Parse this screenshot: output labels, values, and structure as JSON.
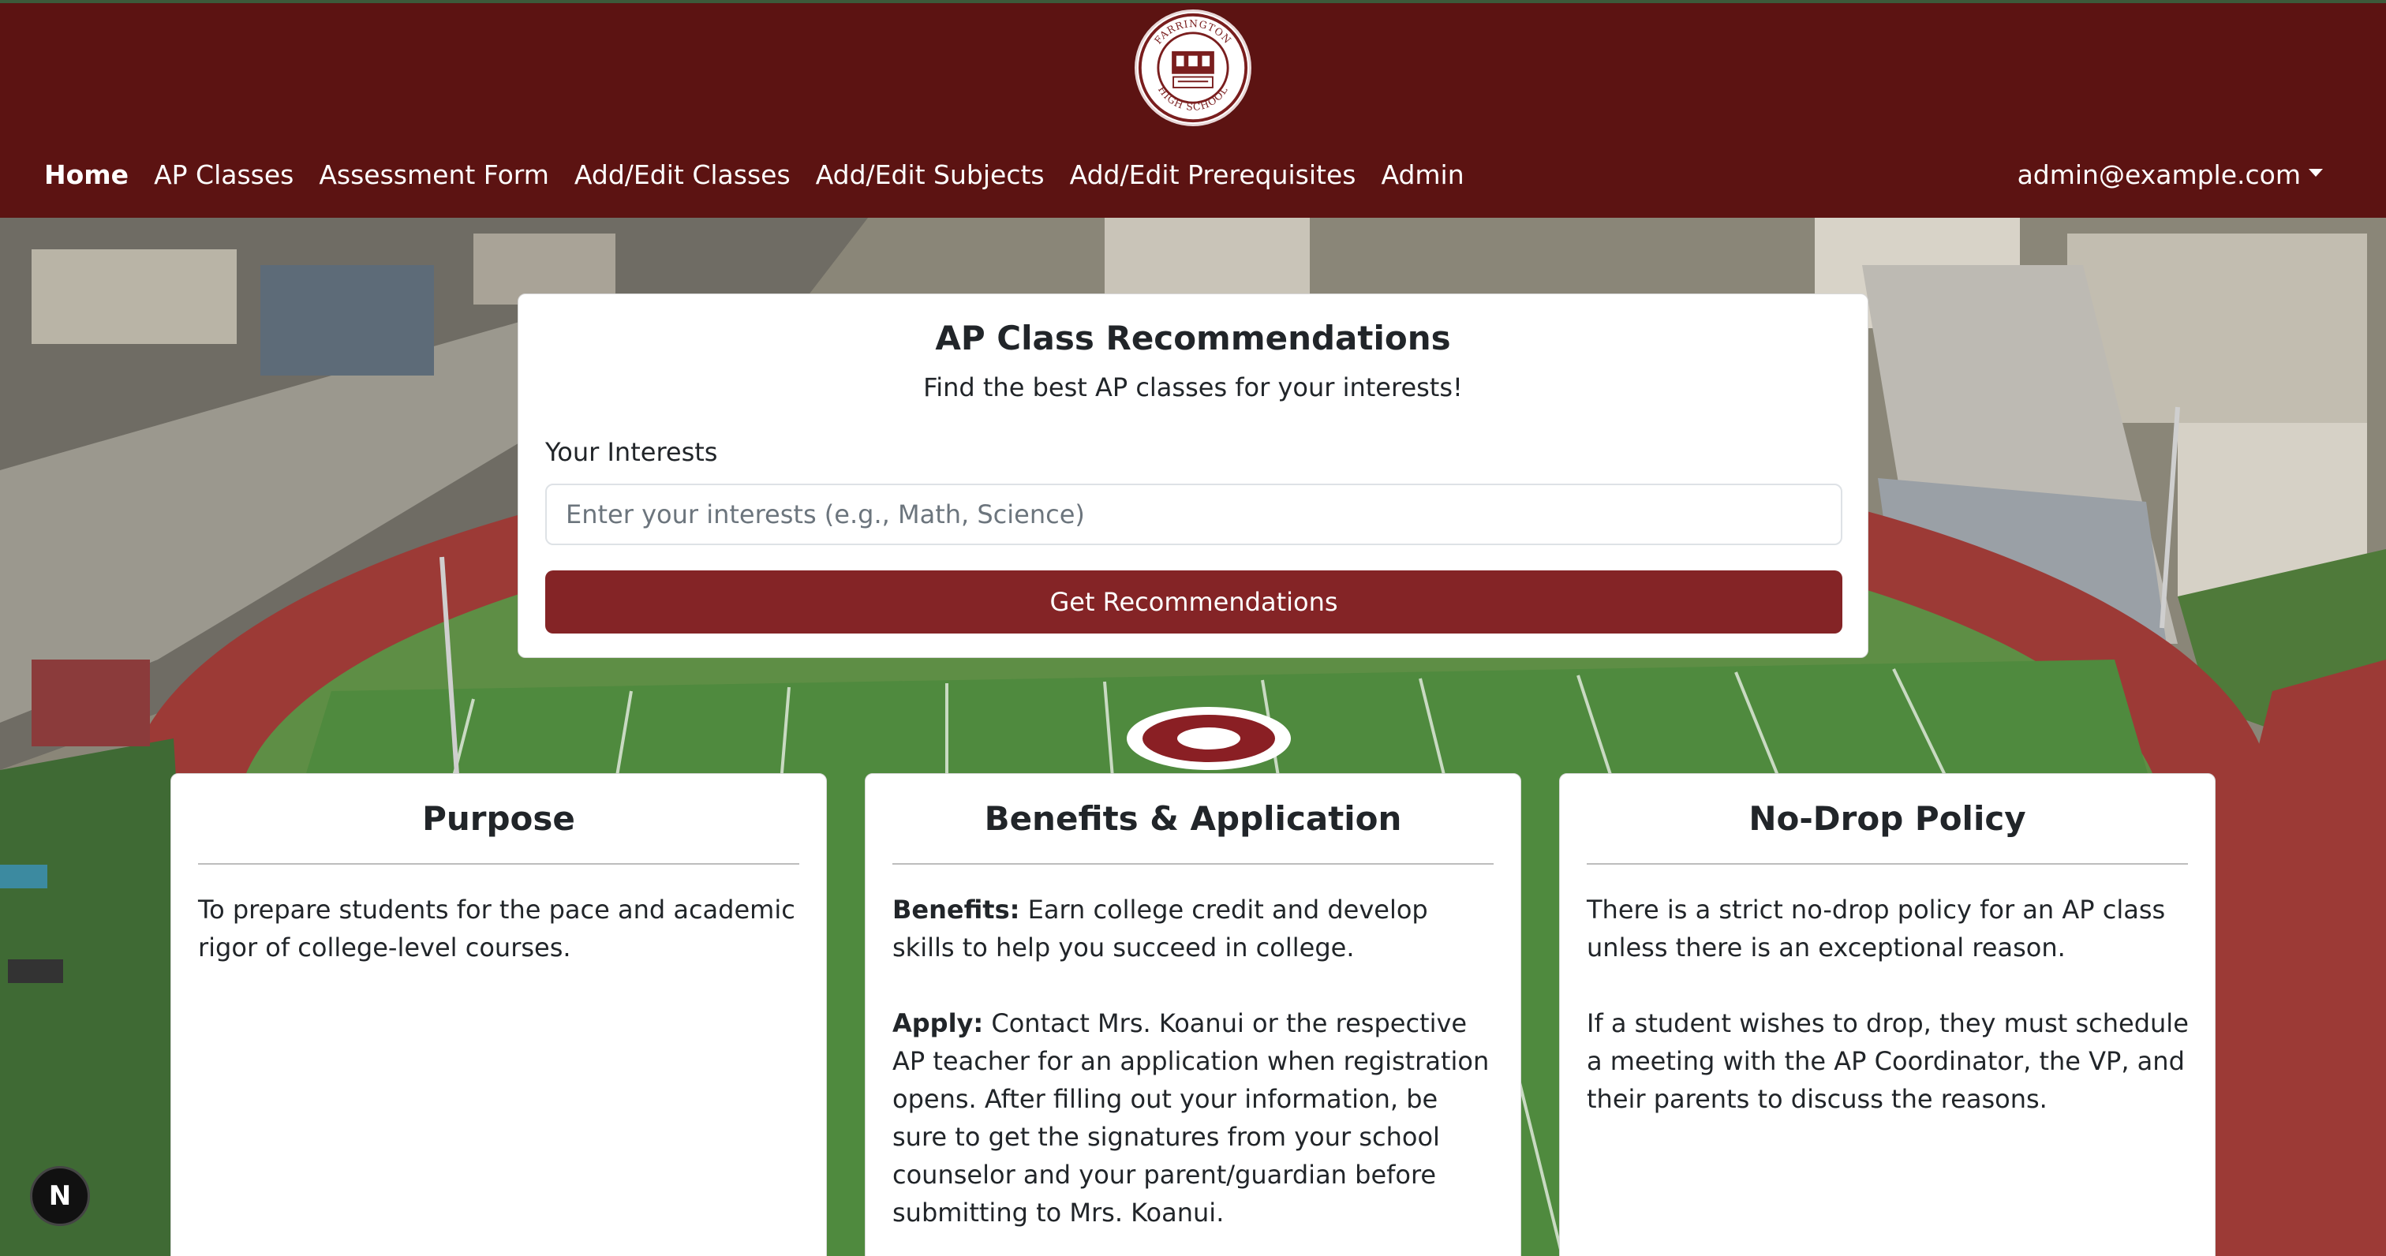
{
  "navbar": {
    "logo_alt": "Farrington High School",
    "logo_text_top": "FARRINGTON",
    "logo_text_bottom": "HIGH SCHOOL",
    "links": [
      {
        "label": "Home",
        "active": true
      },
      {
        "label": "AP Classes"
      },
      {
        "label": "Assessment Form"
      },
      {
        "label": "Add/Edit Classes"
      },
      {
        "label": "Add/Edit Subjects"
      },
      {
        "label": "Add/Edit Prerequisites"
      },
      {
        "label": "Admin"
      }
    ],
    "user_email": "admin@example.com",
    "background_color": "#5c1312"
  },
  "recommendation": {
    "title": "AP Class Recommendations",
    "subtitle": "Find the best AP classes for your interests!",
    "interests_label": "Your Interests",
    "interests_value": "",
    "interests_placeholder": "Enter your interests (e.g., Math, Science)",
    "button_label": "Get Recommendations",
    "button_color": "#842426"
  },
  "cards": {
    "purpose": {
      "title": "Purpose",
      "text": "To prepare students for the pace and academic rigor of college-level courses."
    },
    "benefits": {
      "title": "Benefits & Application",
      "benefits_label": "Benefits:",
      "benefits_text": " Earn college credit and develop skills to help you succeed in college.",
      "apply_label": "Apply:",
      "apply_text": " Contact Mrs. Koanui or the respective AP teacher for an application when registration opens. After filling out your information, be sure to get the signatures from your school counselor and your parent/guardian before submitting to Mrs. Koanui."
    },
    "nodrop": {
      "title": "No-Drop Policy",
      "text_1": "There is a strict no-drop policy for an AP class unless there is an exceptional reason.",
      "text_2": "If a student wishes to drop, they must schedule a meeting with the AP Coordinator, the VP, and their parents to discuss the reasons."
    }
  },
  "next_badge": {
    "label": "N",
    "icon": "nextjs-icon"
  }
}
